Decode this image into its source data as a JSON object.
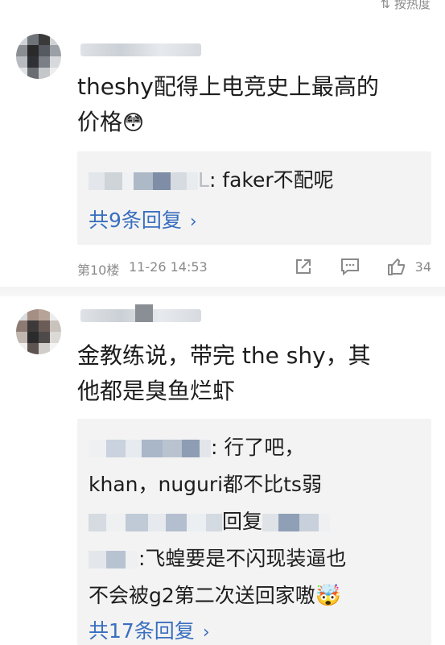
{
  "header": {
    "sort_label": "按热度"
  },
  "comments": [
    {
      "text_line1": "theshy配得上电竞史上最高的",
      "text_line2": "价格",
      "emoji": "😳",
      "reply_text": ": faker不配呢",
      "reply_name_tail": "L",
      "more_replies": "共9条回复",
      "floor": "第10楼",
      "time": "11-26 14:53",
      "likes": "34"
    },
    {
      "text_line1": "金教练说，带完 the shy，其",
      "text_line2": "他都是臭鱼烂虾",
      "reply1_line1": ": 行了吧，",
      "reply1_line2": "khan，nuguri都不比ts弱",
      "reply2_mid": "回复",
      "reply3_line1": ":飞蝗要是不闪现装逼也",
      "reply3_line2": "不会被g2第二次送回家嗷",
      "reply3_emoji": "🤯",
      "more_replies": "共17条回复"
    }
  ],
  "colors": {
    "link": "#3a6fbf",
    "meta": "#8a8a8a",
    "reply_bg": "#f3f3f3"
  },
  "icons": [
    "sort-icon",
    "chevron-right-icon",
    "share-icon",
    "comment-icon",
    "thumbs-up-icon"
  ]
}
